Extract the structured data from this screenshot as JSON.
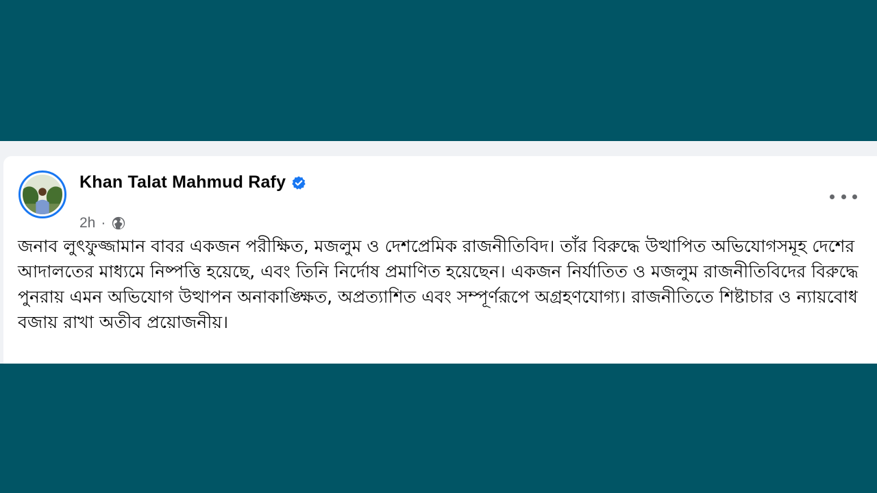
{
  "post": {
    "author_name": "Khan Talat Mahmud Rafy",
    "verified_icon": "verified-badge-icon",
    "time": "2h",
    "separator": "·",
    "audience_icon": "globe-icon",
    "more_icon": "more-options-icon",
    "text": "জনাব লুৎফুজ্জামান বাবর একজন পরীক্ষিত, মজলুম ও দেশপ্রেমিক রাজনীতিবিদ। তাঁর বিরুদ্ধে উত্থাপিত অভিযোগসমূহ দেশের আদালতের মাধ্যমে নিষ্পত্তি হয়েছে, এবং তিনি নির্দোষ প্রমাণিত হয়েছেন। একজন নির্যাতিত ও মজলুম রাজনীতিবিদের বিরুদ্ধে পুনরায় এমন অভিযোগ উত্থাপন অনাকাঙ্ক্ষিত, অপ্রত্যাশিত এবং সম্পূর্ণরূপে অগ্রহণযোগ্য। রাজনীতিতে শিষ্টাচার ও ন্যায়বোধ বজায় রাখা অতীব প্রয়োজনীয়।"
  },
  "colors": {
    "background_teal": "#015565",
    "card": "#ffffff",
    "band": "#f0f2f5",
    "verified_blue": "#1877f2",
    "meta_gray": "#65676b",
    "text": "#050505"
  }
}
